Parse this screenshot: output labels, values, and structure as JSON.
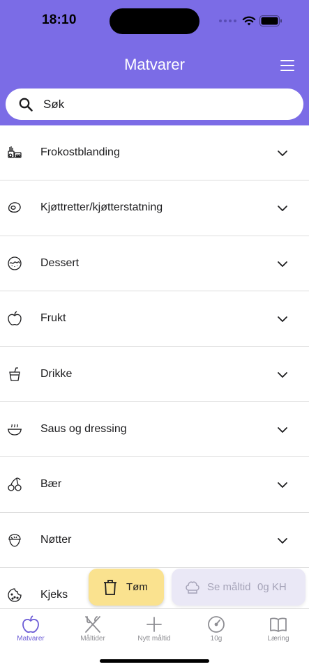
{
  "status": {
    "time": "18:10"
  },
  "header": {
    "title": "Matvarer",
    "menu_icon": "hamburger-icon"
  },
  "search": {
    "placeholder": "Søk",
    "value": ""
  },
  "categories": [
    {
      "label": "Frokostblanding",
      "icon": "cereal-icon"
    },
    {
      "label": "Kjøttretter/kjøtterstatning",
      "icon": "meat-icon"
    },
    {
      "label": "Dessert",
      "icon": "dessert-icon"
    },
    {
      "label": "Frukt",
      "icon": "apple-icon"
    },
    {
      "label": "Drikke",
      "icon": "drink-icon"
    },
    {
      "label": "Saus og dressing",
      "icon": "sauce-icon"
    },
    {
      "label": "Bær",
      "icon": "cherry-icon"
    },
    {
      "label": "Nøtter",
      "icon": "nut-icon"
    },
    {
      "label": "Kjeks",
      "icon": "cookie-icon"
    }
  ],
  "actions": {
    "clear_label": "Tøm",
    "view_meal_label": "Se måltid",
    "view_meal_carbs": "0g KH"
  },
  "tabs": [
    {
      "label": "Matvarer",
      "icon": "apple-icon",
      "active": true
    },
    {
      "label": "Måltider",
      "icon": "fork-knife-icon",
      "active": false
    },
    {
      "label": "Nytt måltid",
      "icon": "plus-icon",
      "active": false
    },
    {
      "label": "10g",
      "icon": "gauge-icon",
      "active": false
    },
    {
      "label": "Læring",
      "icon": "book-icon",
      "active": false
    }
  ],
  "colors": {
    "accent": "#7b6ce6",
    "clear_button": "#fae28f",
    "view_meal_button": "#eae8f6",
    "active_tab": "#6b5bd6"
  }
}
